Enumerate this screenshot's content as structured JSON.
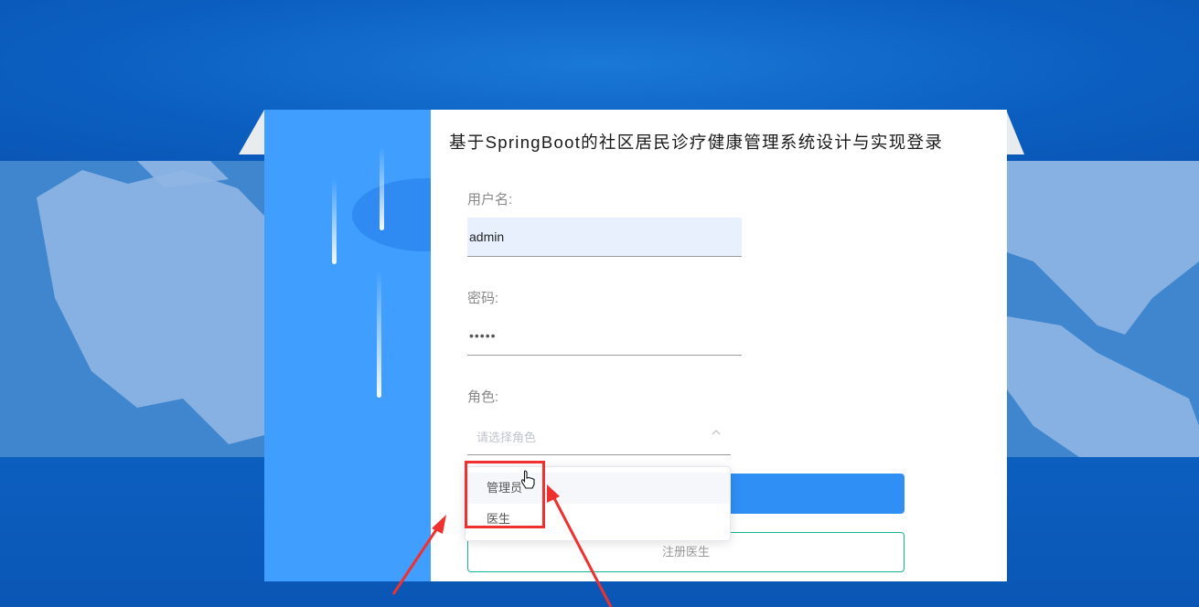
{
  "page": {
    "title": "基于SpringBoot的社区居民诊疗健康管理系统设计与实现登录"
  },
  "form": {
    "username_label": "用户名:",
    "username_value": "admin",
    "password_label": "密码:",
    "password_value": "•••••",
    "role_label": "角色:",
    "role_placeholder": "请选择角色",
    "register_button": "注册医生"
  },
  "dropdown": {
    "options": [
      {
        "label": "管理员",
        "hovered": true
      },
      {
        "label": "医生",
        "hovered": false
      }
    ]
  },
  "colors": {
    "accent": "#409eff",
    "login_button": "#2f8ff5",
    "register_border": "#13b397",
    "annotation": "#f0302f"
  },
  "icons": [
    "arrow-up-icon",
    "hand-cursor-icon"
  ]
}
